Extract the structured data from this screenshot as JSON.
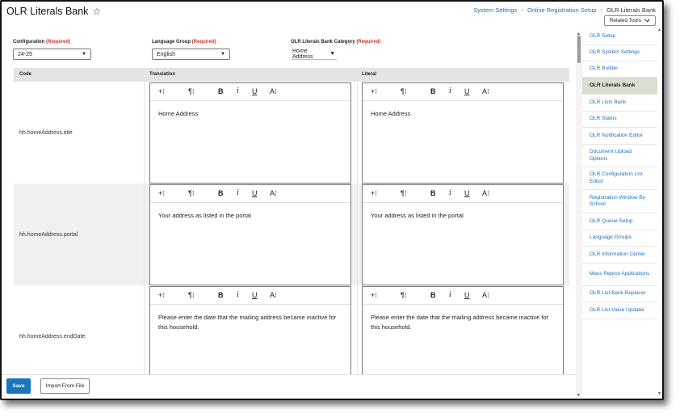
{
  "header": {
    "title": "OLR Literals Bank",
    "favorite_icon": "star-icon",
    "breadcrumb": [
      "System Settings",
      "Online Registration Setup",
      "OLR Literals Bank"
    ],
    "related_tools": "Related Tools"
  },
  "filters": {
    "configuration": {
      "label": "Configuration",
      "required": "(Required)",
      "value": "24-25"
    },
    "language_group": {
      "label": "Language Group",
      "required": "(Required)",
      "value": "English"
    },
    "category": {
      "label": "OLR Literals Bank Category",
      "required": "(Required)",
      "value": "Home Address"
    }
  },
  "table": {
    "columns": [
      "Code",
      "Translation",
      "Literal"
    ],
    "toolbar_icons": [
      "insert-field-icon",
      "paragraph-format-icon",
      "bold-icon",
      "italic-icon",
      "underline-icon",
      "text-size-icon"
    ],
    "toolbar": {
      "insert": "+⁝",
      "paragraph": "¶⁝",
      "bold": "B",
      "italic": "i",
      "underline": "U",
      "text_size": "A⁝"
    },
    "rows": [
      {
        "code": "hh.homeAddress.title",
        "translation": "Home Address",
        "literal": "Home Address"
      },
      {
        "code": "hh.homeAddress.portal",
        "translation": "Your address as listed in the portal",
        "literal": "Your address as listed in the portal"
      },
      {
        "code": "hh.homeAddress.endDate",
        "translation": "Please enter the date that the mailing address became inactive for this household.",
        "literal": "Please enter the date that the mailing address became inactive for this household."
      }
    ]
  },
  "sidebar": {
    "items": [
      {
        "label": "OLR Setup",
        "active": false
      },
      {
        "label": "OLR System Settings",
        "active": false
      },
      {
        "label": "OLR Builder",
        "active": false
      },
      {
        "label": "OLR Literals Bank",
        "active": true
      },
      {
        "label": "OLR Lists Bank",
        "active": false
      },
      {
        "label": "OLR Status",
        "active": false
      },
      {
        "label": "OLR Notification Editor",
        "active": false
      },
      {
        "label": "Document Upload Options",
        "active": false
      },
      {
        "label": "OLR Configuration List Editor",
        "active": false
      },
      {
        "label": "Registration Window By School",
        "active": false
      },
      {
        "label": "OLR Queue Setup",
        "active": false
      },
      {
        "label": "Language Groups",
        "active": false
      },
      {
        "label": "OLR Information Center",
        "active": false
      },
      {
        "label": "Mass Repost Applications",
        "active": false
      },
      {
        "label": "OLR List Bank Replacer",
        "active": false
      },
      {
        "label": "OLR List Value Updater",
        "active": false
      }
    ]
  },
  "actions": {
    "save": "Save",
    "import": "Import From File"
  },
  "colors": {
    "link": "#1d6fb8",
    "required": "#c0392b",
    "save_button": "#1b75bb",
    "active_nav": "#d7dfcf"
  }
}
